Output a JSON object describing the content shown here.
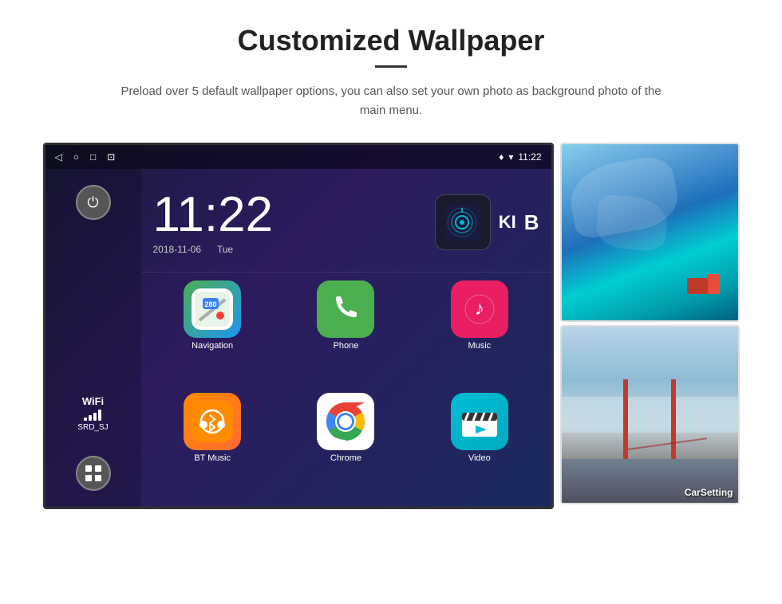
{
  "header": {
    "title": "Customized Wallpaper",
    "subtitle": "Preload over 5 default wallpaper options, you can also set your own photo as background photo of the main menu."
  },
  "statusBar": {
    "time": "11:22",
    "icons": {
      "location": "♦",
      "wifi": "▼"
    }
  },
  "clock": {
    "time": "11:22",
    "date": "2018-11-06",
    "day": "Tue"
  },
  "wifi": {
    "label": "WiFi",
    "network": "SRD_SJ"
  },
  "apps": [
    {
      "name": "Navigation",
      "type": "navigation"
    },
    {
      "name": "Phone",
      "type": "phone"
    },
    {
      "name": "Music",
      "type": "music"
    },
    {
      "name": "BT Music",
      "type": "btmusic"
    },
    {
      "name": "Chrome",
      "type": "chrome"
    },
    {
      "name": "Video",
      "type": "video"
    }
  ],
  "wallpapers": [
    {
      "name": "ice-wallpaper",
      "label": ""
    },
    {
      "name": "bridge-wallpaper",
      "label": "CarSetting"
    }
  ]
}
